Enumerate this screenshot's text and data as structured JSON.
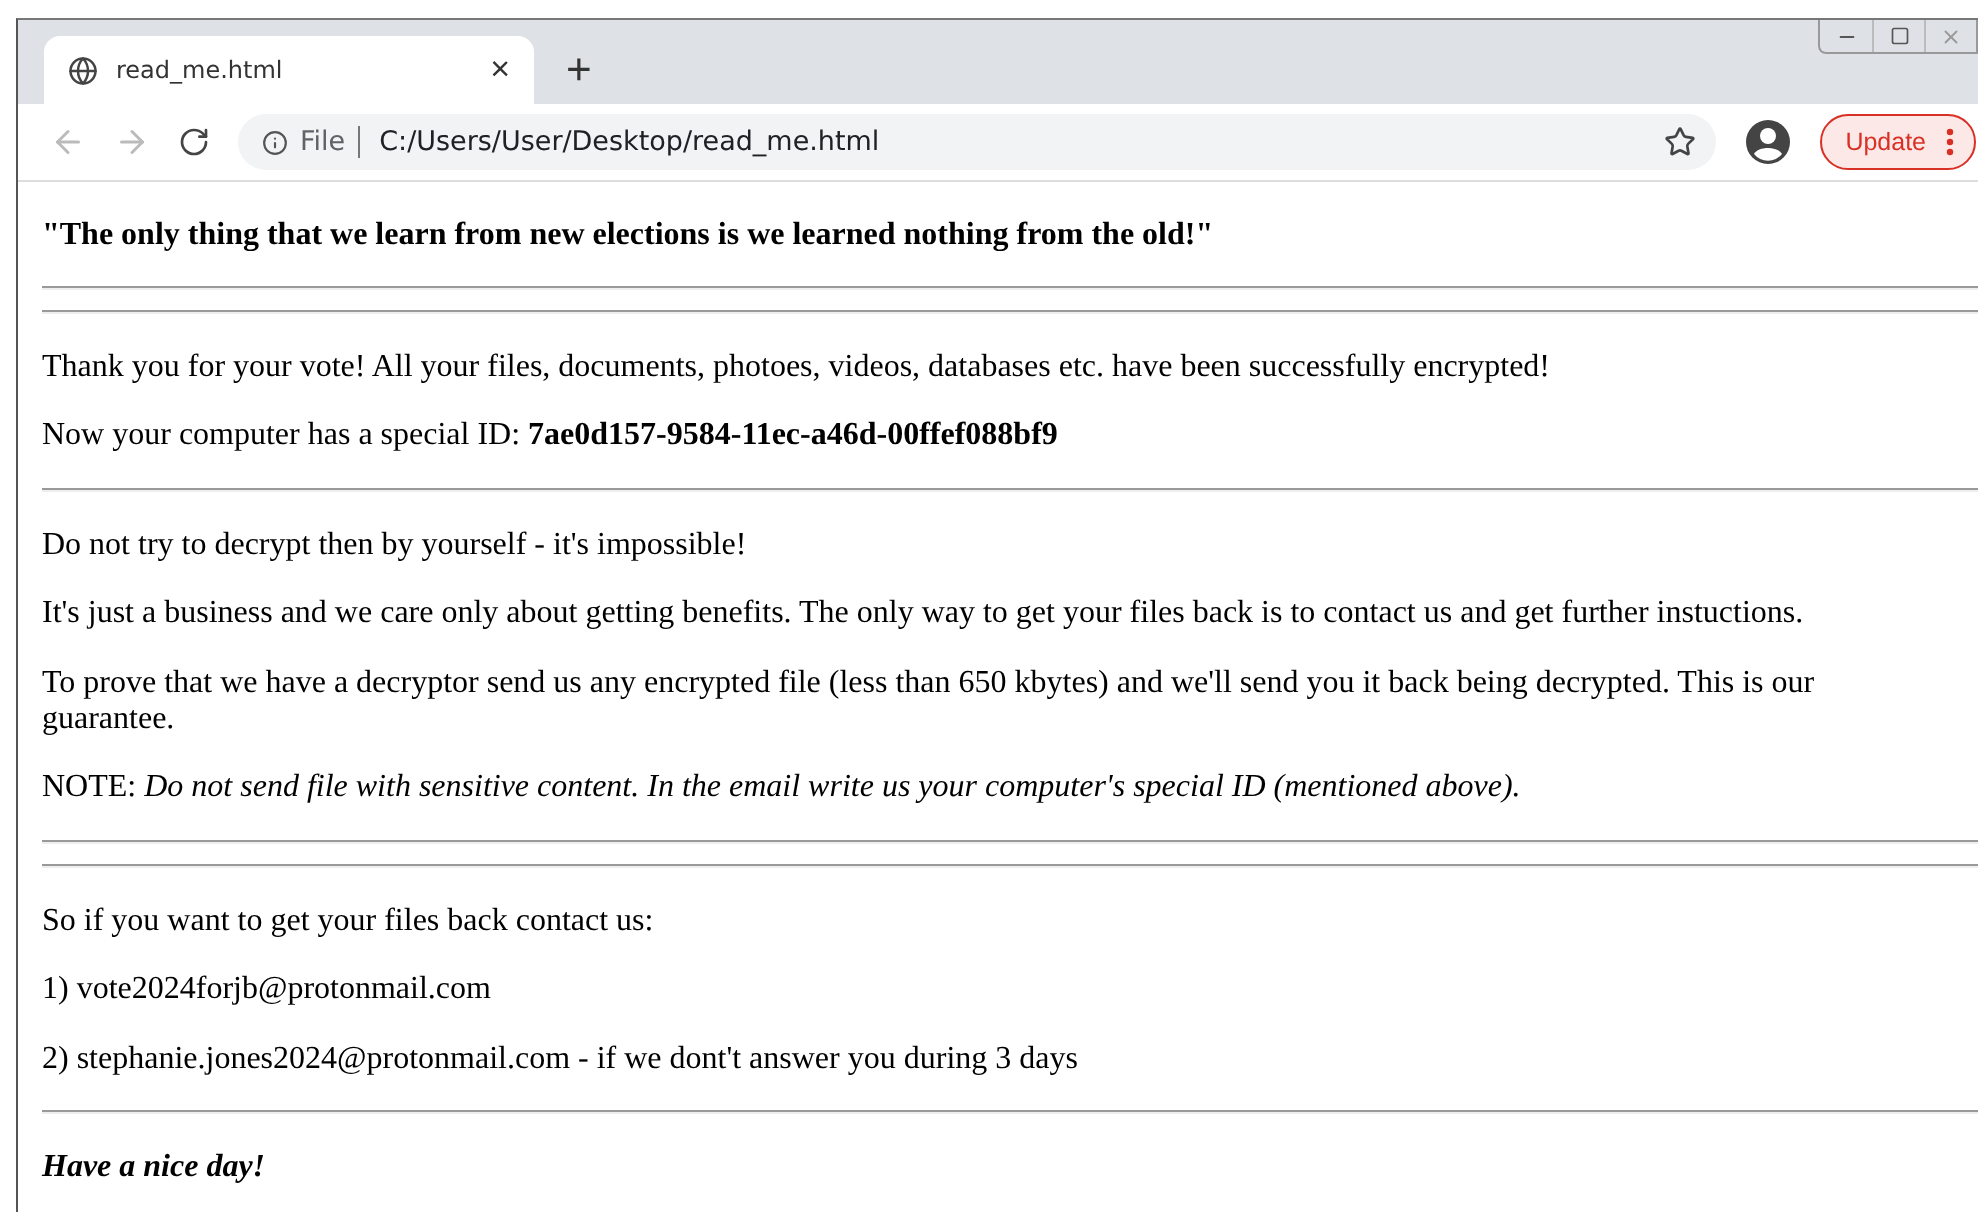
{
  "tab": {
    "title": "read_me.html",
    "close": "×",
    "new_tab": "+"
  },
  "address_bar": {
    "scheme": "File",
    "url": "C:/Users/User/Desktop/read_me.html"
  },
  "update_button": {
    "label": "Update"
  },
  "content": [
    {
      "kind": "heading",
      "text": "\"The only thing that we learn from new elections is we learned nothing from the old!\""
    },
    {
      "kind": "rule"
    },
    {
      "kind": "rule"
    },
    {
      "kind": "para",
      "text": "Thank you for your vote! All your files, documents, photoes, videos, databases etc. have been successfully encrypted!"
    },
    {
      "kind": "para",
      "text": "Now your computer has a special ID: **7ae0d157-9584-11ec-a46d-00ffef088bf9**"
    },
    {
      "kind": "rule"
    },
    {
      "kind": "para",
      "text": "Do not try to decrypt then by yourself - it's impossible!"
    },
    {
      "kind": "para",
      "text": "It's just a business and we care only about getting benefits. The only way to get your files back is to contact us and get further instuctions."
    },
    {
      "kind": "para",
      "text": "To prove that we have a decryptor send us any encrypted file (less than 650 kbytes) and we'll send you it back being decrypted. This is our guarantee."
    },
    {
      "kind": "para",
      "text": "NOTE: *Do not send file with sensitive content. In the email write us your computer's special ID (mentioned above).*"
    },
    {
      "kind": "rule"
    },
    {
      "kind": "rule"
    },
    {
      "kind": "para",
      "text": "So if you want to get your files back contact us:"
    },
    {
      "kind": "para",
      "text": "1) vote2024forjb@protonmail.com"
    },
    {
      "kind": "para",
      "text": "2) stephanie.jones2024@protonmail.com - if we dont't answer you during 3 days"
    },
    {
      "kind": "rule"
    },
    {
      "kind": "signoff",
      "text": "Have a nice day!"
    }
  ]
}
